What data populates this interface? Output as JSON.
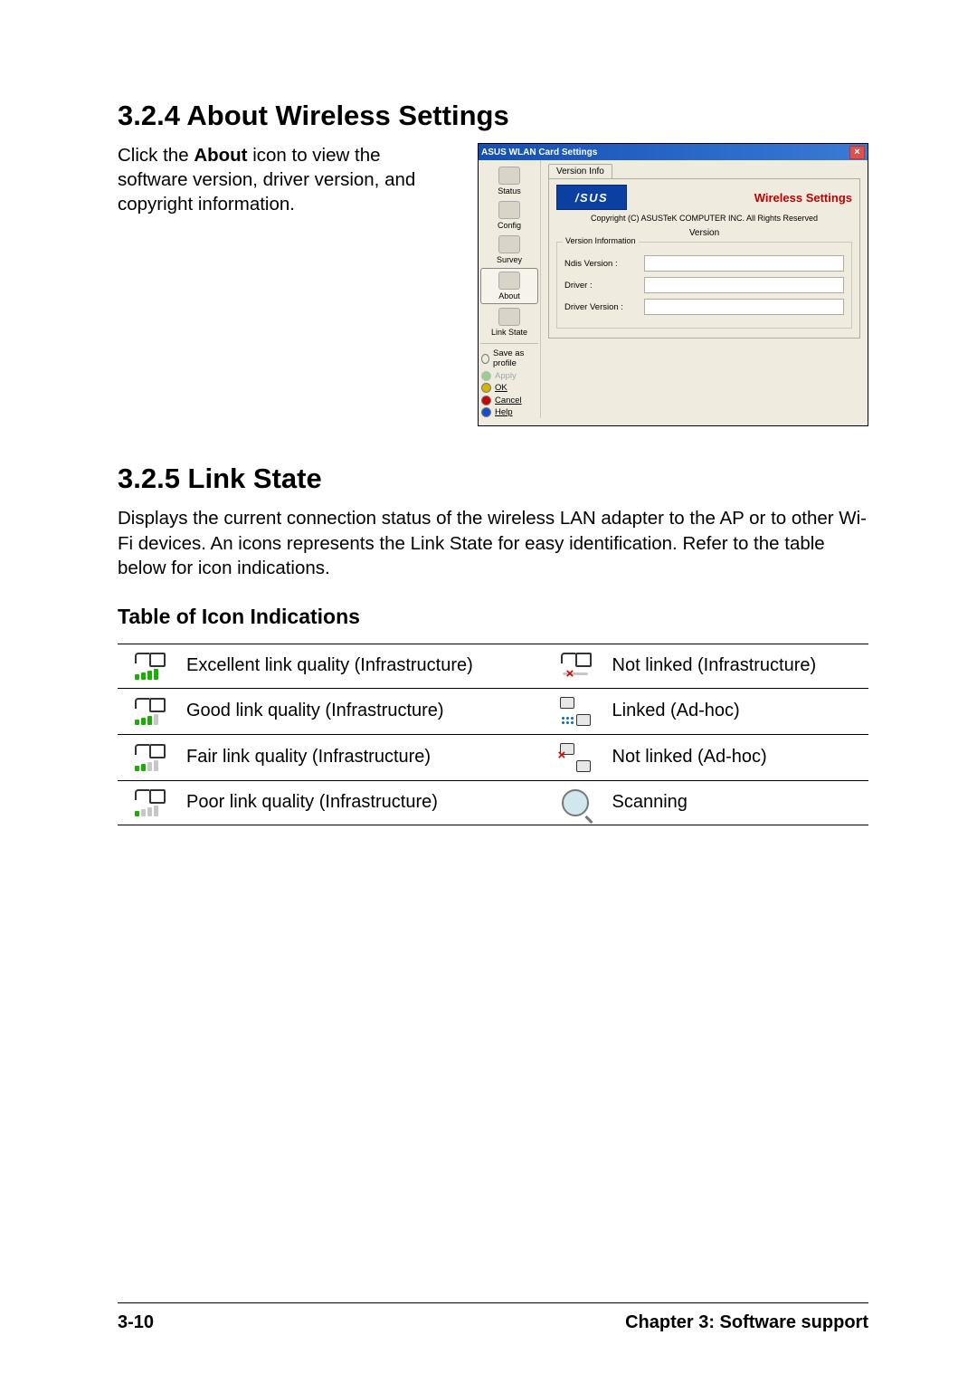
{
  "headings": {
    "h1": "3.2.4   About Wireless Settings",
    "h2": "3.2.5   Link State",
    "h3": "Table of Icon Indications"
  },
  "intro_about": {
    "prefix": "Click the ",
    "bold": "About",
    "suffix": " icon to view the software version, driver version, and copyright information."
  },
  "screenshot": {
    "title": "ASUS WLAN Card Settings",
    "side": [
      "Status",
      "Config",
      "Survey",
      "About",
      "Link State"
    ],
    "side_btns": {
      "save": "Save as profile",
      "apply": "Apply",
      "ok": "OK",
      "cancel": "Cancel",
      "help": "Help"
    },
    "tab": "Version Info",
    "logo": "/SUS",
    "ws": "Wireless Settings",
    "copy": "Copyright (C) ASUSTeK COMPUTER INC. All Rights Reserved",
    "vhdr": "Version",
    "vbox_title": "Version Information",
    "rows": [
      "Ndis Version :",
      "Driver :",
      "Driver Version :"
    ]
  },
  "link_state_body": "Displays the current connection status of the wireless LAN adapter to the AP or to other Wi-Fi devices. An icons represents the Link State for easy identification. Refer to the table below for icon indications.",
  "table": {
    "r1c1": "Excellent link quality (Infrastructure)",
    "r1c2": "Not linked (Infrastructure)",
    "r2c1": "Good link quality (Infrastructure)",
    "r2c2": "Linked (Ad-hoc)",
    "r3c1": "Fair link quality (Infrastructure)",
    "r3c2": "Not linked (Ad-hoc)",
    "r4c1": "Poor link quality (Infrastructure)",
    "r4c2": "Scanning"
  },
  "footer": {
    "page": "3-10",
    "chapter": "Chapter 3: Software support"
  }
}
